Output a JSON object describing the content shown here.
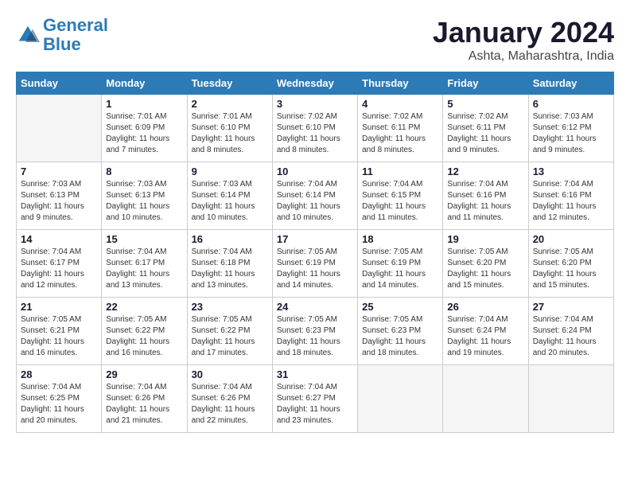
{
  "header": {
    "logo_line1": "General",
    "logo_line2": "Blue",
    "month_year": "January 2024",
    "location": "Ashta, Maharashtra, India"
  },
  "days_of_week": [
    "Sunday",
    "Monday",
    "Tuesday",
    "Wednesday",
    "Thursday",
    "Friday",
    "Saturday"
  ],
  "weeks": [
    [
      {
        "day": "",
        "sunrise": "",
        "sunset": "",
        "daylight": ""
      },
      {
        "day": "1",
        "sunrise": "Sunrise: 7:01 AM",
        "sunset": "Sunset: 6:09 PM",
        "daylight": "Daylight: 11 hours and 7 minutes."
      },
      {
        "day": "2",
        "sunrise": "Sunrise: 7:01 AM",
        "sunset": "Sunset: 6:10 PM",
        "daylight": "Daylight: 11 hours and 8 minutes."
      },
      {
        "day": "3",
        "sunrise": "Sunrise: 7:02 AM",
        "sunset": "Sunset: 6:10 PM",
        "daylight": "Daylight: 11 hours and 8 minutes."
      },
      {
        "day": "4",
        "sunrise": "Sunrise: 7:02 AM",
        "sunset": "Sunset: 6:11 PM",
        "daylight": "Daylight: 11 hours and 8 minutes."
      },
      {
        "day": "5",
        "sunrise": "Sunrise: 7:02 AM",
        "sunset": "Sunset: 6:11 PM",
        "daylight": "Daylight: 11 hours and 9 minutes."
      },
      {
        "day": "6",
        "sunrise": "Sunrise: 7:03 AM",
        "sunset": "Sunset: 6:12 PM",
        "daylight": "Daylight: 11 hours and 9 minutes."
      }
    ],
    [
      {
        "day": "7",
        "sunrise": "Sunrise: 7:03 AM",
        "sunset": "Sunset: 6:13 PM",
        "daylight": "Daylight: 11 hours and 9 minutes."
      },
      {
        "day": "8",
        "sunrise": "Sunrise: 7:03 AM",
        "sunset": "Sunset: 6:13 PM",
        "daylight": "Daylight: 11 hours and 10 minutes."
      },
      {
        "day": "9",
        "sunrise": "Sunrise: 7:03 AM",
        "sunset": "Sunset: 6:14 PM",
        "daylight": "Daylight: 11 hours and 10 minutes."
      },
      {
        "day": "10",
        "sunrise": "Sunrise: 7:04 AM",
        "sunset": "Sunset: 6:14 PM",
        "daylight": "Daylight: 11 hours and 10 minutes."
      },
      {
        "day": "11",
        "sunrise": "Sunrise: 7:04 AM",
        "sunset": "Sunset: 6:15 PM",
        "daylight": "Daylight: 11 hours and 11 minutes."
      },
      {
        "day": "12",
        "sunrise": "Sunrise: 7:04 AM",
        "sunset": "Sunset: 6:16 PM",
        "daylight": "Daylight: 11 hours and 11 minutes."
      },
      {
        "day": "13",
        "sunrise": "Sunrise: 7:04 AM",
        "sunset": "Sunset: 6:16 PM",
        "daylight": "Daylight: 11 hours and 12 minutes."
      }
    ],
    [
      {
        "day": "14",
        "sunrise": "Sunrise: 7:04 AM",
        "sunset": "Sunset: 6:17 PM",
        "daylight": "Daylight: 11 hours and 12 minutes."
      },
      {
        "day": "15",
        "sunrise": "Sunrise: 7:04 AM",
        "sunset": "Sunset: 6:17 PM",
        "daylight": "Daylight: 11 hours and 13 minutes."
      },
      {
        "day": "16",
        "sunrise": "Sunrise: 7:04 AM",
        "sunset": "Sunset: 6:18 PM",
        "daylight": "Daylight: 11 hours and 13 minutes."
      },
      {
        "day": "17",
        "sunrise": "Sunrise: 7:05 AM",
        "sunset": "Sunset: 6:19 PM",
        "daylight": "Daylight: 11 hours and 14 minutes."
      },
      {
        "day": "18",
        "sunrise": "Sunrise: 7:05 AM",
        "sunset": "Sunset: 6:19 PM",
        "daylight": "Daylight: 11 hours and 14 minutes."
      },
      {
        "day": "19",
        "sunrise": "Sunrise: 7:05 AM",
        "sunset": "Sunset: 6:20 PM",
        "daylight": "Daylight: 11 hours and 15 minutes."
      },
      {
        "day": "20",
        "sunrise": "Sunrise: 7:05 AM",
        "sunset": "Sunset: 6:20 PM",
        "daylight": "Daylight: 11 hours and 15 minutes."
      }
    ],
    [
      {
        "day": "21",
        "sunrise": "Sunrise: 7:05 AM",
        "sunset": "Sunset: 6:21 PM",
        "daylight": "Daylight: 11 hours and 16 minutes."
      },
      {
        "day": "22",
        "sunrise": "Sunrise: 7:05 AM",
        "sunset": "Sunset: 6:22 PM",
        "daylight": "Daylight: 11 hours and 16 minutes."
      },
      {
        "day": "23",
        "sunrise": "Sunrise: 7:05 AM",
        "sunset": "Sunset: 6:22 PM",
        "daylight": "Daylight: 11 hours and 17 minutes."
      },
      {
        "day": "24",
        "sunrise": "Sunrise: 7:05 AM",
        "sunset": "Sunset: 6:23 PM",
        "daylight": "Daylight: 11 hours and 18 minutes."
      },
      {
        "day": "25",
        "sunrise": "Sunrise: 7:05 AM",
        "sunset": "Sunset: 6:23 PM",
        "daylight": "Daylight: 11 hours and 18 minutes."
      },
      {
        "day": "26",
        "sunrise": "Sunrise: 7:04 AM",
        "sunset": "Sunset: 6:24 PM",
        "daylight": "Daylight: 11 hours and 19 minutes."
      },
      {
        "day": "27",
        "sunrise": "Sunrise: 7:04 AM",
        "sunset": "Sunset: 6:24 PM",
        "daylight": "Daylight: 11 hours and 20 minutes."
      }
    ],
    [
      {
        "day": "28",
        "sunrise": "Sunrise: 7:04 AM",
        "sunset": "Sunset: 6:25 PM",
        "daylight": "Daylight: 11 hours and 20 minutes."
      },
      {
        "day": "29",
        "sunrise": "Sunrise: 7:04 AM",
        "sunset": "Sunset: 6:26 PM",
        "daylight": "Daylight: 11 hours and 21 minutes."
      },
      {
        "day": "30",
        "sunrise": "Sunrise: 7:04 AM",
        "sunset": "Sunset: 6:26 PM",
        "daylight": "Daylight: 11 hours and 22 minutes."
      },
      {
        "day": "31",
        "sunrise": "Sunrise: 7:04 AM",
        "sunset": "Sunset: 6:27 PM",
        "daylight": "Daylight: 11 hours and 23 minutes."
      },
      {
        "day": "",
        "sunrise": "",
        "sunset": "",
        "daylight": ""
      },
      {
        "day": "",
        "sunrise": "",
        "sunset": "",
        "daylight": ""
      },
      {
        "day": "",
        "sunrise": "",
        "sunset": "",
        "daylight": ""
      }
    ]
  ]
}
